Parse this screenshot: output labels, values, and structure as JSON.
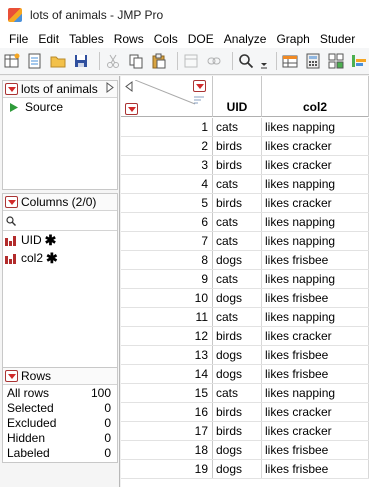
{
  "window": {
    "title": "lots of animals - JMP Pro"
  },
  "menu": [
    "File",
    "Edit",
    "Tables",
    "Rows",
    "Cols",
    "DOE",
    "Analyze",
    "Graph",
    "Studer"
  ],
  "toolbar": {
    "icons": [
      "new-table-icon",
      "open-data-icon",
      "open-folder-icon",
      "save-icon",
      "cut-icon",
      "copy-icon",
      "paste-icon",
      "copy-with-headers-icon",
      "link-icon",
      "search-icon",
      "dropdown-arrow-icon",
      "table-tool-icon",
      "calculator-icon",
      "grid-tool-icon",
      "chart-tool-icon",
      "script-window-icon"
    ]
  },
  "table_panel": {
    "title": "lots of animals",
    "source_label": "Source"
  },
  "columns_panel": {
    "title": "Columns (2/0)",
    "items": [
      {
        "name": "UID"
      },
      {
        "name": "col2"
      }
    ]
  },
  "rows_panel": {
    "title": "Rows",
    "stats": [
      {
        "label": "All rows",
        "value": "100"
      },
      {
        "label": "Selected",
        "value": "0"
      },
      {
        "label": "Excluded",
        "value": "0"
      },
      {
        "label": "Hidden",
        "value": "0"
      },
      {
        "label": "Labeled",
        "value": "0"
      }
    ]
  },
  "grid": {
    "columns": [
      "UID",
      "col2"
    ],
    "rows": [
      {
        "n": "1",
        "uid": "cats",
        "col2": "likes napping"
      },
      {
        "n": "2",
        "uid": "birds",
        "col2": "likes cracker"
      },
      {
        "n": "3",
        "uid": "birds",
        "col2": "likes cracker"
      },
      {
        "n": "4",
        "uid": "cats",
        "col2": "likes napping"
      },
      {
        "n": "5",
        "uid": "birds",
        "col2": "likes cracker"
      },
      {
        "n": "6",
        "uid": "cats",
        "col2": "likes napping"
      },
      {
        "n": "7",
        "uid": "cats",
        "col2": "likes napping"
      },
      {
        "n": "8",
        "uid": "dogs",
        "col2": "likes frisbee"
      },
      {
        "n": "9",
        "uid": "cats",
        "col2": "likes napping"
      },
      {
        "n": "10",
        "uid": "dogs",
        "col2": "likes frisbee"
      },
      {
        "n": "11",
        "uid": "cats",
        "col2": "likes napping"
      },
      {
        "n": "12",
        "uid": "birds",
        "col2": "likes cracker"
      },
      {
        "n": "13",
        "uid": "dogs",
        "col2": "likes frisbee"
      },
      {
        "n": "14",
        "uid": "dogs",
        "col2": "likes frisbee"
      },
      {
        "n": "15",
        "uid": "cats",
        "col2": "likes napping"
      },
      {
        "n": "16",
        "uid": "birds",
        "col2": "likes cracker"
      },
      {
        "n": "17",
        "uid": "birds",
        "col2": "likes cracker"
      },
      {
        "n": "18",
        "uid": "dogs",
        "col2": "likes frisbee"
      },
      {
        "n": "19",
        "uid": "dogs",
        "col2": "likes frisbee"
      }
    ]
  },
  "colors": {
    "accent_red": "#d12b2b",
    "source_green": "#2e9b3a",
    "column_icon_red": "#b22b2b"
  }
}
